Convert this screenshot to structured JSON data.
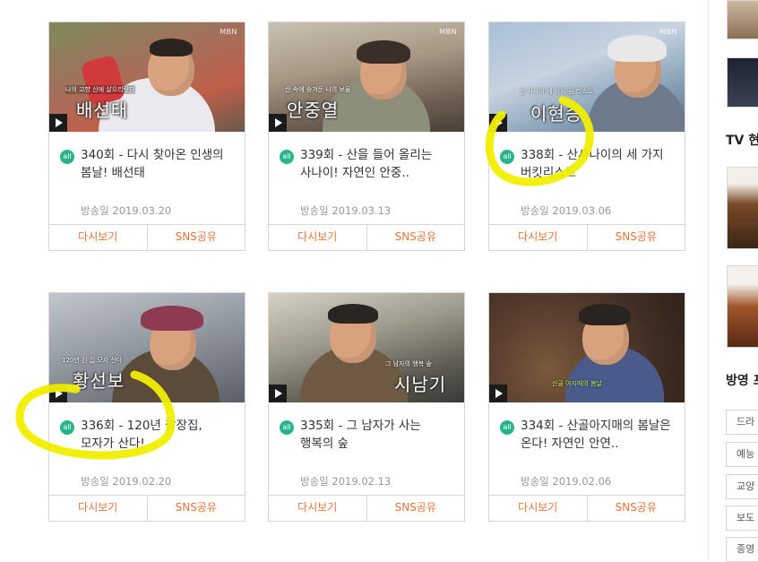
{
  "cards": [
    {
      "title": "340회 - 다시 찾아온 인생의 봄날! 배선태",
      "date_label": "방송일",
      "date": "2019.03.20",
      "badge": "all",
      "replay": "다시보기",
      "share": "SNS공유",
      "channel": "MBN",
      "caption_name": "배선태",
      "caption_top": "나의 고향 산에 살으리랏다"
    },
    {
      "title": "339회 - 산을 들어 올리는 사나이! 자연인 안중..",
      "date_label": "방송일",
      "date": "2019.03.13",
      "badge": "all",
      "replay": "다시보기",
      "share": "SNS공유",
      "channel": "MBN",
      "caption_name": "안중열",
      "caption_top": "산 속에 숨겨둔 나의 보물"
    },
    {
      "title": "338회 - 산사나이의 세 가지 버킷리스트",
      "date_label": "방송일",
      "date": "2019.03.06",
      "badge": "all",
      "replay": "다시보기",
      "share": "SNS공유",
      "channel": "MBN",
      "caption_name": "이현승",
      "caption_top": "산 사나이 세 가지 꿈 리스트"
    },
    {
      "title": "336회 - 120년 깜장집, 모자가 산다!",
      "date_label": "방송일",
      "date": "2019.02.20",
      "badge": "all",
      "replay": "다시보기",
      "share": "SNS공유",
      "channel": "",
      "caption_name": "황선보",
      "caption_top": "120년 된 집 모자 산다"
    },
    {
      "title": "335회 - 그 남자가 사는 행복의 숲",
      "date_label": "방송일",
      "date": "2019.02.13",
      "badge": "all",
      "replay": "다시보기",
      "share": "SNS공유",
      "channel": "",
      "caption_name": "시남기",
      "caption_top": "그 남자의 행복 숲"
    },
    {
      "title": "334회 - 산골아지매의 봄날은 온다! 자연인 안연..",
      "date_label": "방송일",
      "date": "2019.02.06",
      "badge": "all",
      "replay": "다시보기",
      "share": "SNS공유",
      "channel": "",
      "caption_name": "",
      "caption_top": "산골 아지매의 봄날"
    }
  ],
  "sidebar": {
    "section1_title": "TV 현",
    "section2_title": "방영 프",
    "categories": [
      "드라",
      "예능",
      "교양",
      "보도",
      "종영"
    ]
  },
  "colors": {
    "accent": "#e8743b",
    "badge": "#27b38c",
    "highlight": "#f2ee00"
  }
}
